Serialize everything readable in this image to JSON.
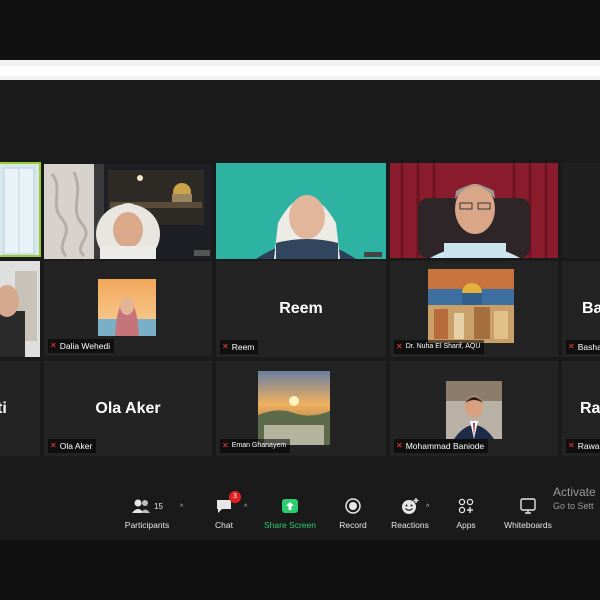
{
  "participants": {
    "tiles": [
      {
        "id": "guna",
        "display_name": "",
        "label": ""
      },
      {
        "id": "woman-mosque",
        "display_name": "",
        "label": ""
      },
      {
        "id": "woman-green",
        "display_name": "",
        "label": ""
      },
      {
        "id": "man-red",
        "display_name": "",
        "label": ""
      },
      {
        "id": "dalia",
        "display_name": "",
        "label": "Dalia Wehedi"
      },
      {
        "id": "reem",
        "display_name": "Reem",
        "label": "Reem"
      },
      {
        "id": "nuha",
        "display_name": "",
        "label": "Dr. Nuha El Sharif, AQU"
      },
      {
        "id": "basha",
        "display_name": "Ba",
        "label": "Basha"
      },
      {
        "id": "ti",
        "display_name": "ti",
        "label": ""
      },
      {
        "id": "ola",
        "display_name": "Ola Aker",
        "label": "Ola Aker"
      },
      {
        "id": "eman",
        "display_name": "",
        "label": "Eman Ghanayem"
      },
      {
        "id": "mohammad",
        "display_name": "",
        "label": "Mohammad Baniode"
      },
      {
        "id": "rawa",
        "display_name": "Ra",
        "label": "Rawa"
      }
    ]
  },
  "toolbar": {
    "participants": {
      "label": "Participants",
      "count": "15",
      "icon": "participants-icon"
    },
    "chat": {
      "label": "Chat",
      "badge": "3",
      "icon": "chat-icon"
    },
    "share": {
      "label": "Share Screen",
      "icon": "share-screen-icon",
      "color": "#2ecc71"
    },
    "record": {
      "label": "Record",
      "icon": "record-icon"
    },
    "reactions": {
      "label": "Reactions",
      "icon": "reactions-icon"
    },
    "apps": {
      "label": "Apps",
      "icon": "apps-icon"
    },
    "whiteboards": {
      "label": "Whiteboards",
      "icon": "whiteboards-icon"
    }
  },
  "watermark": {
    "line1": "Activate",
    "line2": "Go to Sett"
  },
  "colors": {
    "active_speaker": "#9acd32",
    "muted_mic": "#ff3b30",
    "badge": "#e02020"
  }
}
